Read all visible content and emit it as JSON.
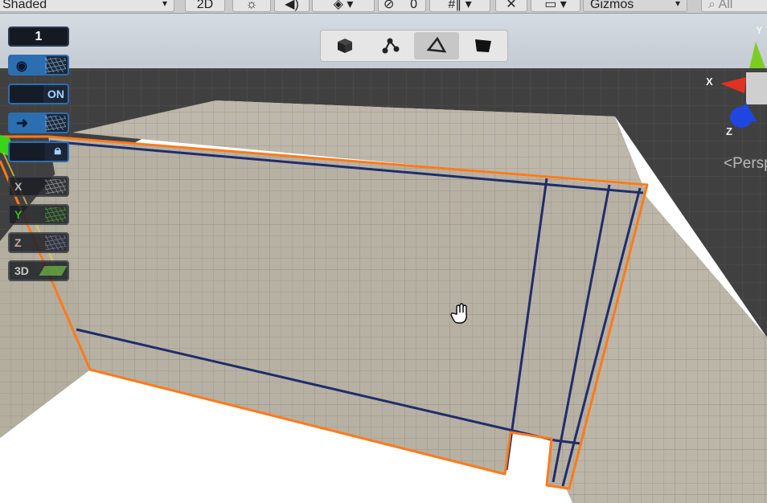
{
  "toolbar": {
    "shading_mode": "Shaded",
    "view_2d": "2D",
    "effects_count": "0",
    "gizmos_label": "Gizmos",
    "search_placeholder": "All"
  },
  "left_tools": {
    "counter_value": "1",
    "toggle_label": "ON",
    "axis_x": "X",
    "axis_y": "Y",
    "axis_z": "Z",
    "mode_3d": "3D"
  },
  "modes": [
    {
      "name": "object-mode",
      "icon": "cube-icon"
    },
    {
      "name": "vertex-mode",
      "icon": "vertices-icon"
    },
    {
      "name": "edge-mode",
      "icon": "edge-icon"
    },
    {
      "name": "face-mode",
      "icon": "face-icon"
    }
  ],
  "selected_mode": "edge-mode",
  "gizmo": {
    "x": "X",
    "y": "Y",
    "z": "Z"
  },
  "projection_label": "Persp",
  "colors": {
    "selection": "#ff7a1a",
    "edge": "#1f2d6b",
    "accent": "#2b6fb0",
    "wall": "#b7b1a3"
  }
}
